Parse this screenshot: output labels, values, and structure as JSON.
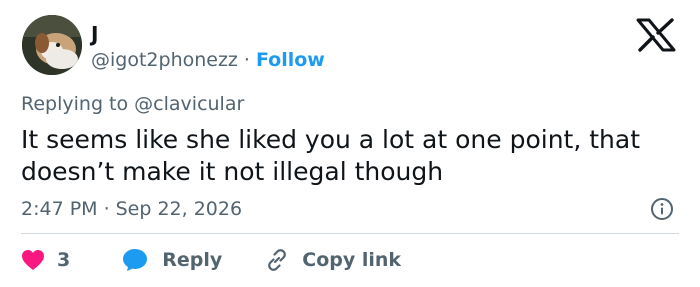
{
  "user": {
    "display_name": "J",
    "handle": "@igot2phonezz",
    "separator": "·",
    "follow_label": "Follow"
  },
  "reply_context": {
    "prefix": "Replying to",
    "mention": "@clavicular"
  },
  "tweet": {
    "text": "It seems like she liked you a lot at one point, that doesn’t make it not illegal though",
    "time": "2:47 PM",
    "separator": "·",
    "date": "Sep 22, 2026"
  },
  "actions": {
    "like_count": "3",
    "reply_label": "Reply",
    "copy_link_label": "Copy link"
  },
  "icons": {
    "platform": "x-logo-icon",
    "info": "info-icon",
    "like": "heart-icon",
    "reply": "speech-bubble-icon",
    "copy": "link-icon"
  },
  "colors": {
    "link": "#1d9bf0",
    "muted": "#536471",
    "text": "#0f1419",
    "heart": "#f91880",
    "divider": "#cfd9de"
  }
}
